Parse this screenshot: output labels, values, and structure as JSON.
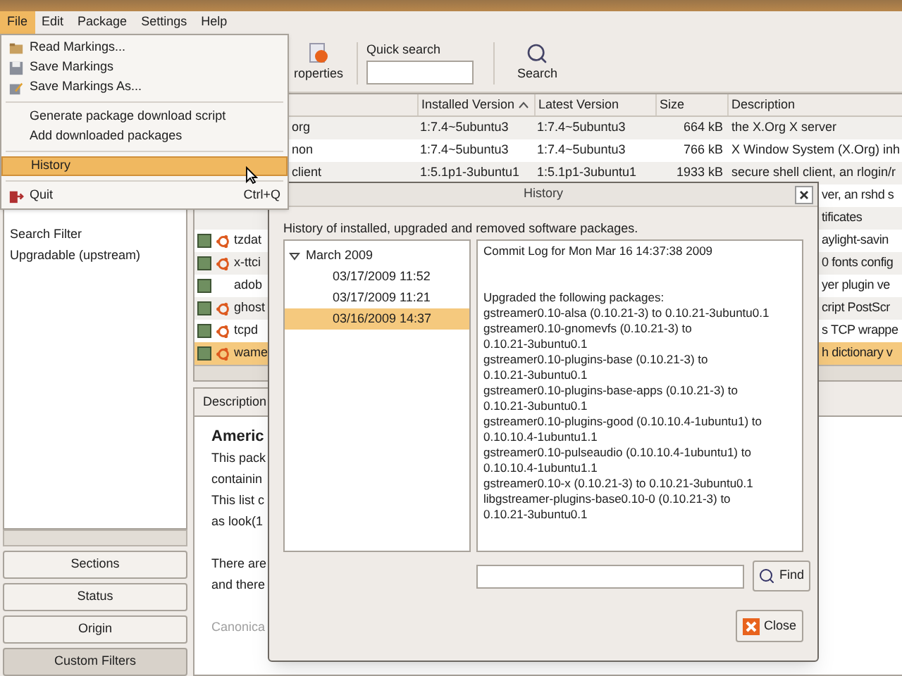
{
  "menubar": [
    {
      "label": "File",
      "selected": true
    },
    {
      "label": "Edit",
      "selected": false
    },
    {
      "label": "Package",
      "selected": false
    },
    {
      "label": "Settings",
      "selected": false
    },
    {
      "label": "Help",
      "selected": false
    }
  ],
  "file_menu": [
    {
      "kind": "open",
      "label": "Read Markings...",
      "selected": false
    },
    {
      "kind": "save",
      "label": "Save Markings",
      "selected": false
    },
    {
      "kind": "saveas",
      "label": "Save Markings As...",
      "selected": false
    },
    {
      "kind": "separator"
    },
    {
      "kind": "plain",
      "label": "Generate package download script",
      "selected": false
    },
    {
      "kind": "plain",
      "label": "Add downloaded packages",
      "selected": false
    },
    {
      "kind": "separator"
    },
    {
      "kind": "plain",
      "label": "History",
      "selected": true
    },
    {
      "kind": "separator"
    },
    {
      "kind": "quit",
      "label": "Quit",
      "shortcut": "Ctrl+Q",
      "selected": false
    }
  ],
  "toolbar": {
    "buttons": [
      {
        "kind": "properties",
        "label": "roperties"
      },
      {
        "kind": "search",
        "label": "Search"
      }
    ],
    "quick_search": {
      "label": "Quick search"
    }
  },
  "filters": {
    "items": [
      {
        "label": "Search Filter",
        "selected": false
      },
      {
        "label": "Upgradable (upstream)",
        "selected": false
      }
    ],
    "buttons": [
      {
        "label": "Sections",
        "selected": false
      },
      {
        "label": "Status",
        "selected": false
      },
      {
        "label": "Origin",
        "selected": false
      },
      {
        "label": "Custom Filters",
        "selected": true
      }
    ]
  },
  "table": {
    "columns": [
      {
        "label": "Installed Version",
        "sorted": true
      },
      {
        "label": "Latest Version",
        "sorted": false
      },
      {
        "label": "Size",
        "sorted": false
      },
      {
        "label": "Description",
        "sorted": false
      }
    ],
    "rows": [
      {
        "name": "org",
        "installed": "1:7.4~5ubuntu3",
        "latest": "1:7.4~5ubuntu3",
        "size": "664 kB",
        "description": "the X.Org X server",
        "selected": false
      },
      {
        "name": "non",
        "installed": "1:7.4~5ubuntu3",
        "latest": "1:7.4~5ubuntu3",
        "size": "766 kB",
        "description": "X Window System (X.Org) inh",
        "selected": false
      },
      {
        "name": "client",
        "installed": "1:5.1p1-3ubuntu1",
        "latest": "1:5.1p1-3ubuntu1",
        "size": "1933 kB",
        "description": "secure shell client, an rlogin/r",
        "selected": false
      },
      {
        "description": "ver, an rshd s",
        "selected": false
      },
      {
        "description": "tificates",
        "selected": false
      },
      {
        "name": "tzdat",
        "marked_installed": true,
        "ubuntu_icon": true,
        "description": "aylight-savin",
        "selected": false
      },
      {
        "name": "x-ttci",
        "marked_installed": true,
        "ubuntu_icon": true,
        "description": "0 fonts config",
        "selected": false
      },
      {
        "name": "adob",
        "marked_installed": true,
        "ubuntu_icon": false,
        "description": "yer plugin ve",
        "selected": false
      },
      {
        "name": "ghost",
        "marked_installed": true,
        "ubuntu_icon": true,
        "description": "cript PostScr",
        "selected": false
      },
      {
        "name": "tcpd",
        "marked_installed": true,
        "ubuntu_icon": true,
        "description": "s TCP wrappe",
        "selected": false
      },
      {
        "name": "wame",
        "marked_installed": true,
        "ubuntu_icon": true,
        "description": "h dictionary v",
        "selected": true
      }
    ]
  },
  "details": {
    "tab": "Description",
    "heading": "Americ",
    "paragraphs": [
      {
        "muted": false,
        "lines": [
          "This pack",
          "containin",
          "This list c",
          "as look(1"
        ]
      },
      {
        "muted": false,
        "lines": [
          "There are",
          "and there"
        ]
      },
      {
        "muted": true,
        "lines": [
          "Canonica"
        ]
      }
    ]
  },
  "dialog": {
    "title": "History",
    "intro": "History of installed, upgraded and removed software packages.",
    "tree": [
      {
        "label": "March 2009",
        "expanded": true,
        "children": [
          {
            "label": "03/17/2009 11:52",
            "selected": false
          },
          {
            "label": "03/17/2009 11:21",
            "selected": false
          },
          {
            "label": "03/16/2009 14:37",
            "selected": true
          }
        ]
      }
    ],
    "log": {
      "header": "Commit Log for Mon Mar 16 14:37:38 2009",
      "lines": [
        "Upgraded the following packages:",
        "gstreamer0.10-alsa (0.10.21-3) to 0.10.21-3ubuntu0.1",
        "gstreamer0.10-gnomevfs (0.10.21-3) to",
        "0.10.21-3ubuntu0.1",
        "gstreamer0.10-plugins-base (0.10.21-3) to",
        "0.10.21-3ubuntu0.1",
        "gstreamer0.10-plugins-base-apps (0.10.21-3) to",
        "0.10.21-3ubuntu0.1",
        "gstreamer0.10-plugins-good (0.10.10.4-1ubuntu1) to",
        "0.10.10.4-1ubuntu1.1",
        "gstreamer0.10-pulseaudio (0.10.10.4-1ubuntu1) to",
        "0.10.10.4-1ubuntu1.1",
        "gstreamer0.10-x (0.10.21-3) to 0.10.21-3ubuntu0.1",
        "libgstreamer-plugins-base0.10-0 (0.10.21-3) to",
        "0.10.21-3ubuntu0.1"
      ]
    },
    "find_button": "Find",
    "close_button": "Close"
  }
}
